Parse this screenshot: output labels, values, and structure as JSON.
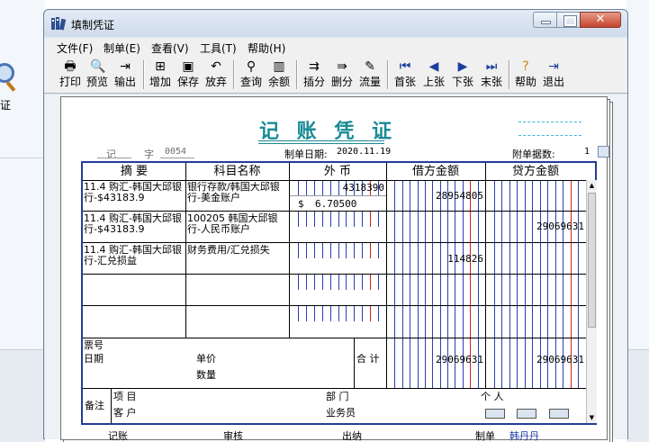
{
  "window": {
    "title": "填制凭证"
  },
  "menu": [
    "文件(F)",
    "制单(E)",
    "查看(V)",
    "工具(T)",
    "帮助(H)"
  ],
  "toolbar": {
    "print": "打印",
    "preview": "预览",
    "export": "输出",
    "add": "增加",
    "save": "保存",
    "discard": "放弃",
    "query": "查询",
    "balance": "余额",
    "insert_row": "插分",
    "delete_row": "删分",
    "cashflow": "流量",
    "first": "首张",
    "prev": "上张",
    "next": "下张",
    "last": "末张",
    "help": "帮助",
    "exit": "退出"
  },
  "background": {
    "left_text": "证"
  },
  "voucher": {
    "title": "记 账 凭 证",
    "type_label": "记",
    "zi_label": "字",
    "number": "0054",
    "date_label": "制单日期:",
    "date": "2020.11.19",
    "attach_label": "附单据数:",
    "attach_count": "1",
    "columns": {
      "summary": "摘 要",
      "account": "科目名称",
      "foreign": "外 币",
      "debit": "借方金额",
      "credit": "贷方金额"
    },
    "rows": [
      {
        "summary": "11.4 购汇-韩国大邱银行-$43183.9",
        "account": "银行存款/韩国大邱银行-美金账户",
        "foreign_amount": "4318390",
        "currency_symbol": "$",
        "exchange_rate": "6.70500",
        "debit": "28954805",
        "credit": ""
      },
      {
        "summary": "11.4 购汇-韩国大邱银行-$43183.9",
        "account": "100205 韩国大邱银行-人民币账户",
        "foreign_amount": "",
        "currency_symbol": "",
        "exchange_rate": "",
        "debit": "",
        "credit": "29069631"
      },
      {
        "summary": "11.4 购汇-韩国大邱银行-汇兑损益",
        "account": "财务费用/汇兑损失",
        "foreign_amount": "",
        "currency_symbol": "",
        "exchange_rate": "",
        "debit": "114826",
        "credit": ""
      }
    ],
    "bill_no_label": "票号",
    "date_row_label": "日期",
    "unit_price_label": "单价",
    "quantity_label": "数量",
    "total_label": "合 计",
    "total_debit": "29069631",
    "total_credit": "29069631",
    "remark_label": "备注",
    "project_label": "项 目",
    "department_label": "部 门",
    "person_label": "个 人",
    "customer_label": "客 户",
    "salesperson_label": "业务员"
  },
  "footer": {
    "booked_label": "记账",
    "audit_label": "审核",
    "cashier_label": "出纳",
    "maker_label": "制单",
    "maker_name": "韩丹丹"
  },
  "colors": {
    "title": "#1a8a95",
    "grid_border": "#233c9a",
    "digit_line": "#2a3fb5",
    "unit_line": "#d02020"
  }
}
